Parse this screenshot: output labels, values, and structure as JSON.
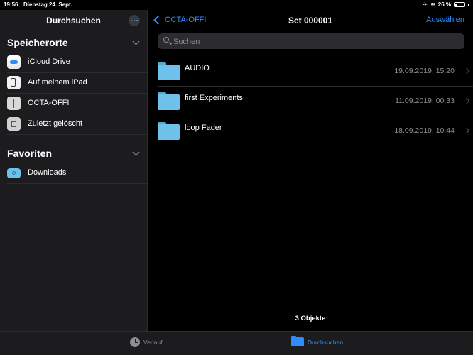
{
  "status_bar": {
    "time": "19:56",
    "date": "Dienstag 24. Sept.",
    "battery_percent": "26 %",
    "battery_level": 0.26
  },
  "sidebar": {
    "title": "Durchsuchen",
    "sections": [
      {
        "title": "Speicherorte",
        "items": [
          {
            "label": "iCloud Drive",
            "icon": "icloud-icon"
          },
          {
            "label": "Auf meinem iPad",
            "icon": "ipad-icon"
          },
          {
            "label": "OCTA-OFFI",
            "icon": "usb-icon"
          },
          {
            "label": "Zuletzt gelöscht",
            "icon": "trash-icon"
          }
        ]
      },
      {
        "title": "Favoriten",
        "items": [
          {
            "label": "Downloads",
            "icon": "downloads-folder-icon"
          }
        ]
      }
    ]
  },
  "main": {
    "back_label": "OCTA-OFFI",
    "title": "Set 000001",
    "select_label": "Auswählen",
    "search_placeholder": "Suchen",
    "files": [
      {
        "name": "AUDIO",
        "date": "19.09.2019, 15:20"
      },
      {
        "name": "first Experiments",
        "date": "11.09.2019, 00:33"
      },
      {
        "name": "loop Fader",
        "date": "18.09.2019, 10:44"
      }
    ],
    "item_count": "3 Objekte"
  },
  "tab_bar": {
    "tabs": [
      {
        "label": "Verlauf",
        "icon": "clock-icon",
        "active": false
      },
      {
        "label": "Durchsuchen",
        "icon": "folder-icon",
        "active": true
      }
    ]
  },
  "colors": {
    "accent": "#2f8cff",
    "folder": "#6ec1ea",
    "sidebar_bg": "#1c1c1e",
    "background": "#000000"
  }
}
